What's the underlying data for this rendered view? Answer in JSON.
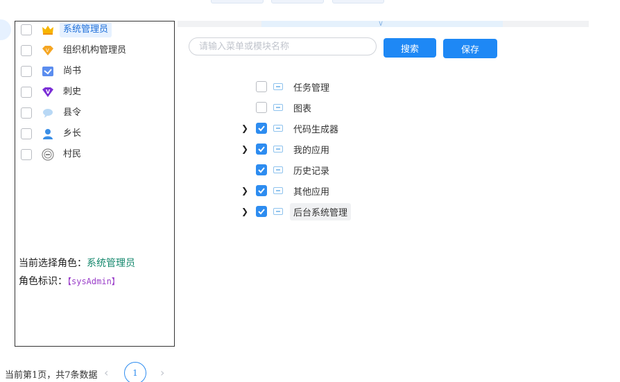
{
  "roles": {
    "items": [
      {
        "label": "系统管理员",
        "icon": "crown-icon",
        "checked": false,
        "active": true
      },
      {
        "label": "组织机构管理员",
        "icon": "vip-diamond-icon",
        "checked": false,
        "active": false
      },
      {
        "label": "尚书",
        "icon": "check-envelope-icon",
        "checked": false,
        "active": false
      },
      {
        "label": "刺史",
        "icon": "purple-v-gem-icon",
        "checked": false,
        "active": false
      },
      {
        "label": "县令",
        "icon": "chat-bubble-icon",
        "checked": false,
        "active": false
      },
      {
        "label": "乡长",
        "icon": "user-avatar-icon",
        "checked": false,
        "active": false
      },
      {
        "label": "村民",
        "icon": "seal-badge-icon",
        "checked": false,
        "active": false
      }
    ],
    "current_role_label": "当前选择角色：",
    "current_role_value": "系统管理员",
    "role_code_label": "角色标识：",
    "role_code_value": "【sysAdmin】"
  },
  "pagination": {
    "total_text": "当前第1页，共7条数据",
    "current_page": "1",
    "prev_icon": "‹",
    "next_icon": "›"
  },
  "toolbar": {
    "collapse_icon": "∨",
    "search_placeholder": "请输入菜单或模块名称",
    "search_value": "",
    "search_button": "搜索",
    "save_button": "保存"
  },
  "menu_tree": [
    {
      "label": "任务管理",
      "checked": false,
      "expandable": false
    },
    {
      "label": "图表",
      "checked": false,
      "expandable": false
    },
    {
      "label": "代码生成器",
      "checked": true,
      "expandable": true
    },
    {
      "label": "我的应用",
      "checked": true,
      "expandable": true
    },
    {
      "label": "历史记录",
      "checked": true,
      "expandable": false
    },
    {
      "label": "其他应用",
      "checked": true,
      "expandable": true
    },
    {
      "label": "后台系统管理",
      "checked": true,
      "expandable": true
    }
  ],
  "colors": {
    "primary": "#1e88f5",
    "active_bg": "#e6f1ff",
    "current_role_value": "#13876c",
    "role_code_value": "#9a3ec9"
  }
}
